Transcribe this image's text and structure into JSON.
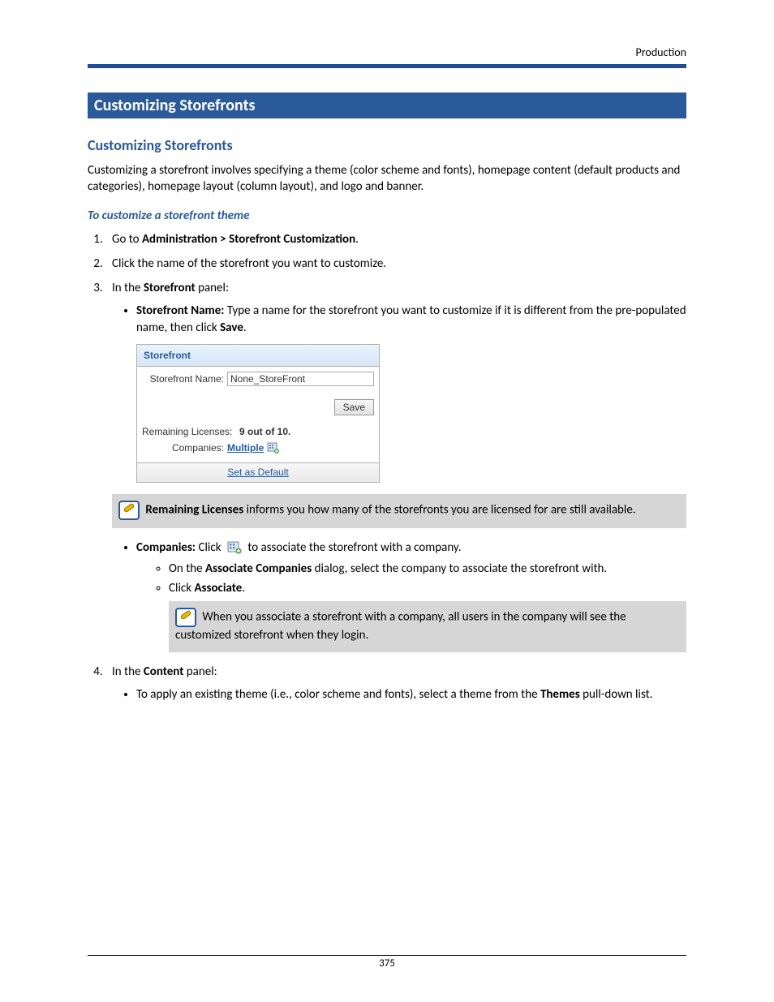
{
  "header": {
    "section": "Production"
  },
  "banner": "Customizing Storefronts",
  "subheading": "Customizing Storefronts",
  "intro": "Customizing a storefront involves specifying a theme (color scheme and fonts), homepage content (default products and categories), homepage layout (column layout), and logo and banner.",
  "procedure_title": "To customize a storefront theme",
  "steps": {
    "s1": {
      "prefix": "Go to ",
      "bold": "Administration > Storefront Customization",
      "suffix": "."
    },
    "s2": "Click the name of the storefront you want to customize.",
    "s3": {
      "prefix": "In the ",
      "bold": "Storefront",
      "suffix": " panel:"
    },
    "s3_bullets": {
      "b1": {
        "label": "Storefront Name:",
        "text_a": " Type a name for the storefront you want to customize if it is different from the pre-populated name, then click ",
        "bold_b": "Save",
        "text_c": "."
      },
      "b2": {
        "label": "Companies:",
        "text_a": " Click ",
        "text_b": " to associate the storefront with a company."
      },
      "b2_sub": {
        "i1": {
          "prefix": "On the ",
          "bold": "Associate Companies",
          "suffix": " dialog, select the company to associate the storefront with."
        },
        "i2": {
          "prefix": "Click ",
          "bold": "Associate",
          "suffix": "."
        }
      }
    },
    "s4": {
      "prefix": "In the ",
      "bold": "Content",
      "suffix": " panel:"
    },
    "s4_bullets": {
      "b1": {
        "text_a": "To apply an existing theme (i.e., color scheme and fonts), select a theme from the ",
        "bold": "Themes",
        "text_b": " pull-down list."
      }
    }
  },
  "panel": {
    "title": "Storefront",
    "name_label": "Storefront Name:",
    "name_value": "None_StoreFront",
    "save": "Save",
    "licenses_label": "Remaining Licenses:",
    "licenses_value": "9 out of 10.",
    "companies_label": "Companies:",
    "companies_value": "Multiple",
    "footer_link": "Set as Default"
  },
  "note1": {
    "bold": "Remaining Licenses",
    "text": " informs you how many of the storefronts you are licensed for are still available."
  },
  "note2": {
    "text": "When you associate a storefront with a company, all users in the company will see the customized storefront when they login."
  },
  "footer_page": "375"
}
